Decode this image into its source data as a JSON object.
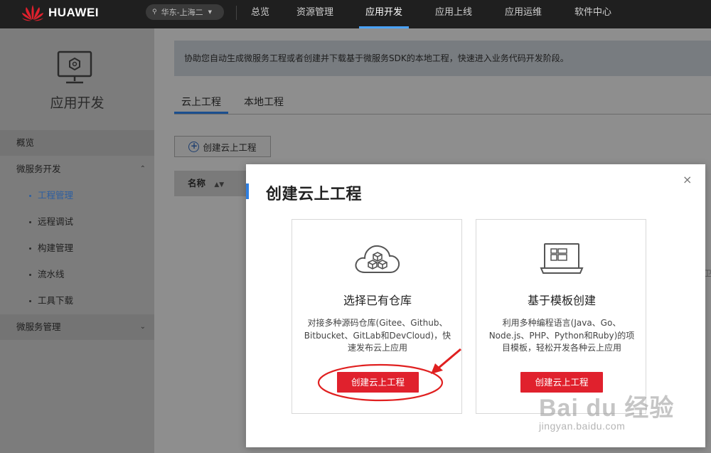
{
  "header": {
    "brand": "HUAWEI",
    "region": "华东-上海二",
    "nav": [
      "总览",
      "资源管理",
      "应用开发",
      "应用上线",
      "应用运维",
      "软件中心"
    ],
    "active_nav": "应用开发"
  },
  "sidebar": {
    "title": "应用开发",
    "overview": "概览",
    "group1": "微服务开发",
    "sub_items": [
      "工程管理",
      "远程调试",
      "构建管理",
      "流水线",
      "工具下载"
    ],
    "active_sub": "工程管理",
    "group2": "微服务管理"
  },
  "main": {
    "notice": "协助您自动生成微服务工程或者创建并下载基于微服务SDK的本地工程，快速进入业务代码开发阶段。",
    "tabs": [
      "云上工程",
      "本地工程"
    ],
    "create_button": "创建云上工程",
    "table_header_name": "名称"
  },
  "modal": {
    "title": "创建云上工程",
    "close": "×",
    "cards": [
      {
        "title": "选择已有仓库",
        "desc": "对接多种源码仓库(Gitee、Github、Bitbucket、GitLab和DevCloud)，快速发布云上应用",
        "button": "创建云上工程",
        "icon": "cloud-cubes-icon"
      },
      {
        "title": "基于模板创建",
        "desc": "利用多种编程语言(Java、Go、Node.js、PHP、Python和Ruby)的项目模板，轻松开发各种云上应用",
        "button": "创建云上工程",
        "icon": "laptop-template-icon"
      }
    ]
  },
  "watermark": {
    "main": "Bai du 经验",
    "sub": "jingyan.baidu.com"
  },
  "edge_text": "卫",
  "colors": {
    "accent_red": "#e0212d",
    "accent_blue": "#2f7fe0",
    "annotation_red": "#e02020"
  }
}
